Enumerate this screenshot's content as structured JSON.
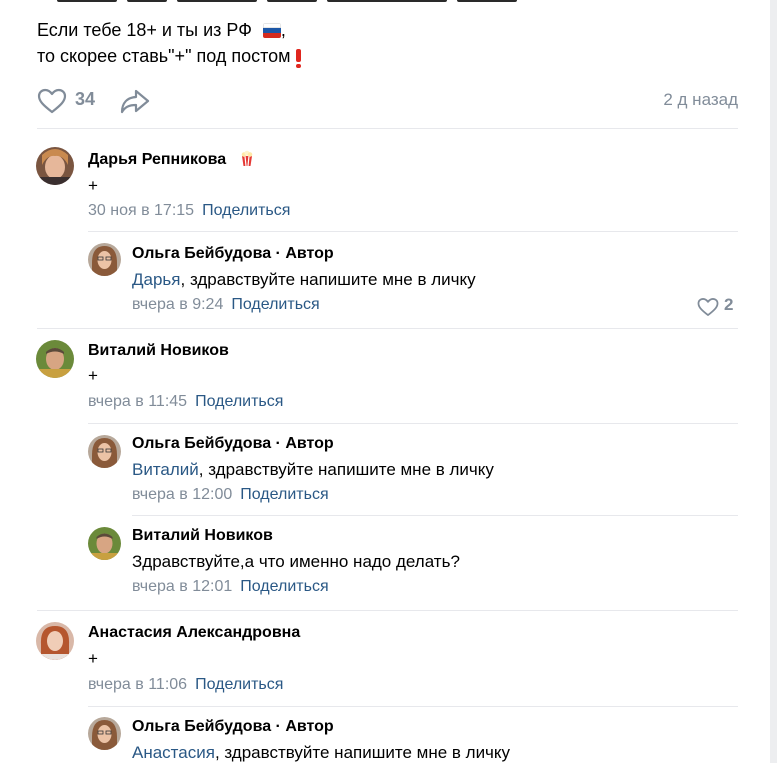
{
  "post": {
    "line1": "Если тебе 18+ и ты из РФ",
    "line2": "то скорее ставь\"+\" под постом",
    "comma": ",",
    "likes": "34",
    "date": "2 д назад"
  },
  "comments": [
    {
      "name": "Дарья Репникова",
      "text": "+",
      "date": "30 ноя в 17:15",
      "share": "Поделиться"
    },
    {
      "name": "Ольга Бейбудова · Автор",
      "mention": "Дарья",
      "text": ", здравствуйте напишите мне в личку",
      "date": "вчера в 9:24",
      "share": "Поделиться",
      "likes": "2"
    },
    {
      "name": "Виталий Новиков",
      "text": "+",
      "date": "вчера в 11:45",
      "share": "Поделиться"
    },
    {
      "name": "Ольга Бейбудова · Автор",
      "mention": "Виталий",
      "text": ", здравствуйте напишите мне в личку",
      "date": "вчера в 12:00",
      "share": "Поделиться"
    },
    {
      "name": "Виталий Новиков",
      "text": "Здравствуйте,а что именно надо делать?",
      "date": "вчера в 12:01",
      "share": "Поделиться"
    },
    {
      "name": "Анастасия Александровна",
      "text": "+",
      "date": "вчера в 11:06",
      "share": "Поделиться"
    },
    {
      "name": "Ольга Бейбудова · Автор",
      "mention": "Анастасия",
      "text": ", здравствуйте напишите мне в личку"
    }
  ],
  "icons": {
    "like": "heart-icon",
    "share": "share-arrow-icon",
    "flag": "russia-flag-icon",
    "exclamation": "red-exclamation-icon",
    "popcorn": "popcorn-icon"
  },
  "colors": {
    "link": "#2a5885",
    "secondary": "#818c99",
    "separator": "#e7e8ec"
  }
}
